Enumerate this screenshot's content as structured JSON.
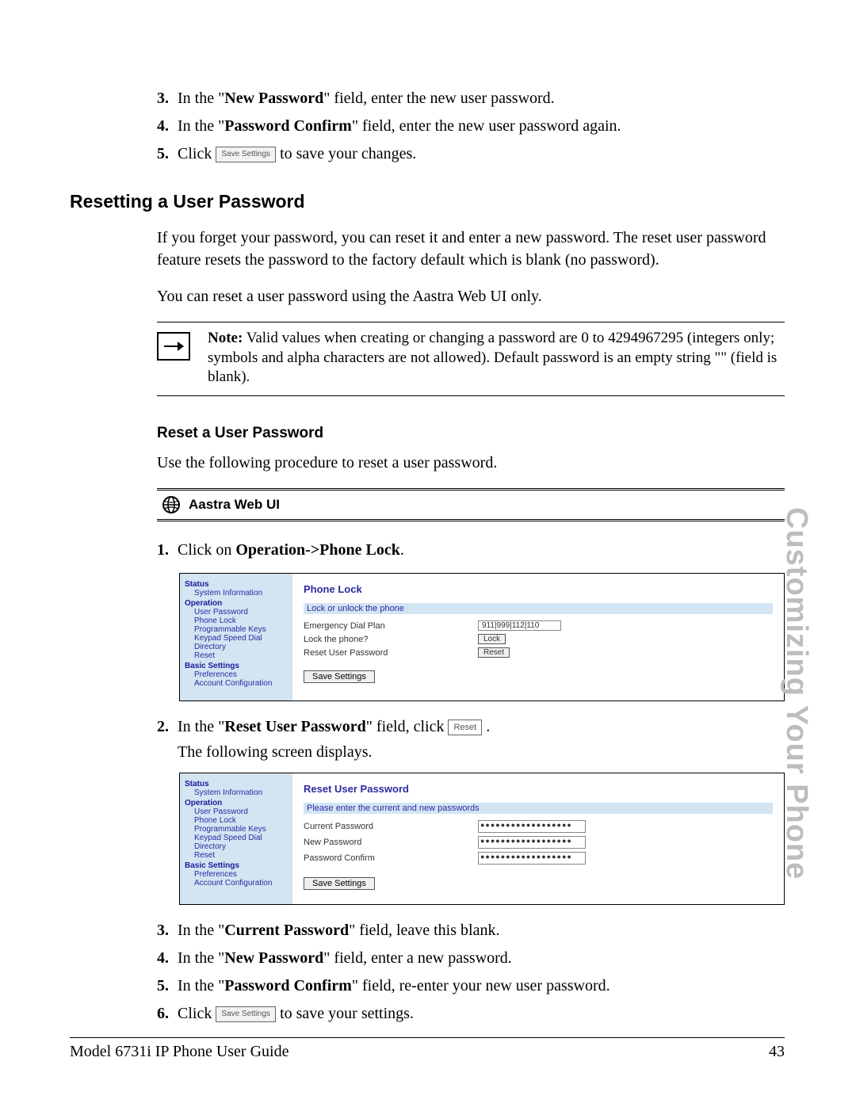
{
  "top_steps": [
    {
      "num": "3.",
      "prefix": "In the \"",
      "bold": "New Password",
      "suffix": "\" field, enter the new user password."
    },
    {
      "num": "4.",
      "prefix": "In the \"",
      "bold": "Password Confirm",
      "suffix": "\" field, enter the new user password again."
    }
  ],
  "step5": {
    "num": "5.",
    "click": "Click ",
    "btn": "Save Settings",
    "tail": " to save your changes."
  },
  "heading1": "Resetting a User Password",
  "para1": "If you forget your password, you can reset it and enter a new password. The reset user password feature resets the password to the factory default which is blank (no password).",
  "para2": "You can reset a user password using the Aastra Web UI only.",
  "note_label": "Note:",
  "note_text": " Valid values when creating or changing a password are 0 to 4294967295 (integers only; symbols and alpha characters are not allowed). Default password is an empty string \"\" (field is blank).",
  "heading2": "Reset a User Password",
  "para3": "Use the following procedure to reset a user password.",
  "uibar_label": "Aastra Web UI",
  "step_b1": {
    "num": "1.",
    "pre": "Click on ",
    "bold": "Operation->Phone Lock",
    "post": "."
  },
  "nav": {
    "status": "Status",
    "sysinfo": "System Information",
    "operation": "Operation",
    "userpw": "User Password",
    "phonelock": "Phone Lock",
    "progkeys": "Programmable Keys",
    "keypad": "Keypad Speed Dial",
    "directory": "Directory",
    "reset": "Reset",
    "basic": "Basic Settings",
    "prefs": "Preferences",
    "account": "Account Configuration"
  },
  "ss1": {
    "title": "Phone Lock",
    "sub": "Lock or unlock the phone",
    "r1l": "Emergency Dial Plan",
    "r1v": "911|999|112|110",
    "r2l": "Lock the phone?",
    "r2b": "Lock",
    "r3l": "Reset User Password",
    "r3b": "Reset",
    "save": "Save Settings"
  },
  "step_b2": {
    "num": "2.",
    "pre": "In the \"",
    "bold": "Reset User Password",
    "mid": "\" field, click  ",
    "btn": "Reset",
    "post": " ."
  },
  "step_b2_line2": "The following screen displays.",
  "ss2": {
    "title": "Reset User Password",
    "sub": "Please enter the current and new passwords",
    "r1l": "Current Password",
    "r2l": "New Password",
    "r3l": "Password Confirm",
    "mask": "●●●●●●●●●●●●●●●●●●",
    "save": "Save Settings"
  },
  "bottom_steps": [
    {
      "num": "3.",
      "prefix": "In the \"",
      "bold": "Current Password",
      "suffix": "\" field, leave this blank."
    },
    {
      "num": "4.",
      "prefix": "In the \"",
      "bold": "New Password",
      "suffix": "\" field, enter a new password."
    },
    {
      "num": "5.",
      "prefix": "In the \"",
      "bold": "Password Confirm",
      "suffix": "\" field, re-enter your new user password."
    }
  ],
  "step_b6": {
    "num": "6.",
    "click": "Click ",
    "btn": "Save Settings",
    "tail": " to save your settings."
  },
  "side_tab": "Customizing Your Phone",
  "footer_left": "Model 6731i IP Phone User Guide",
  "footer_right": "43"
}
